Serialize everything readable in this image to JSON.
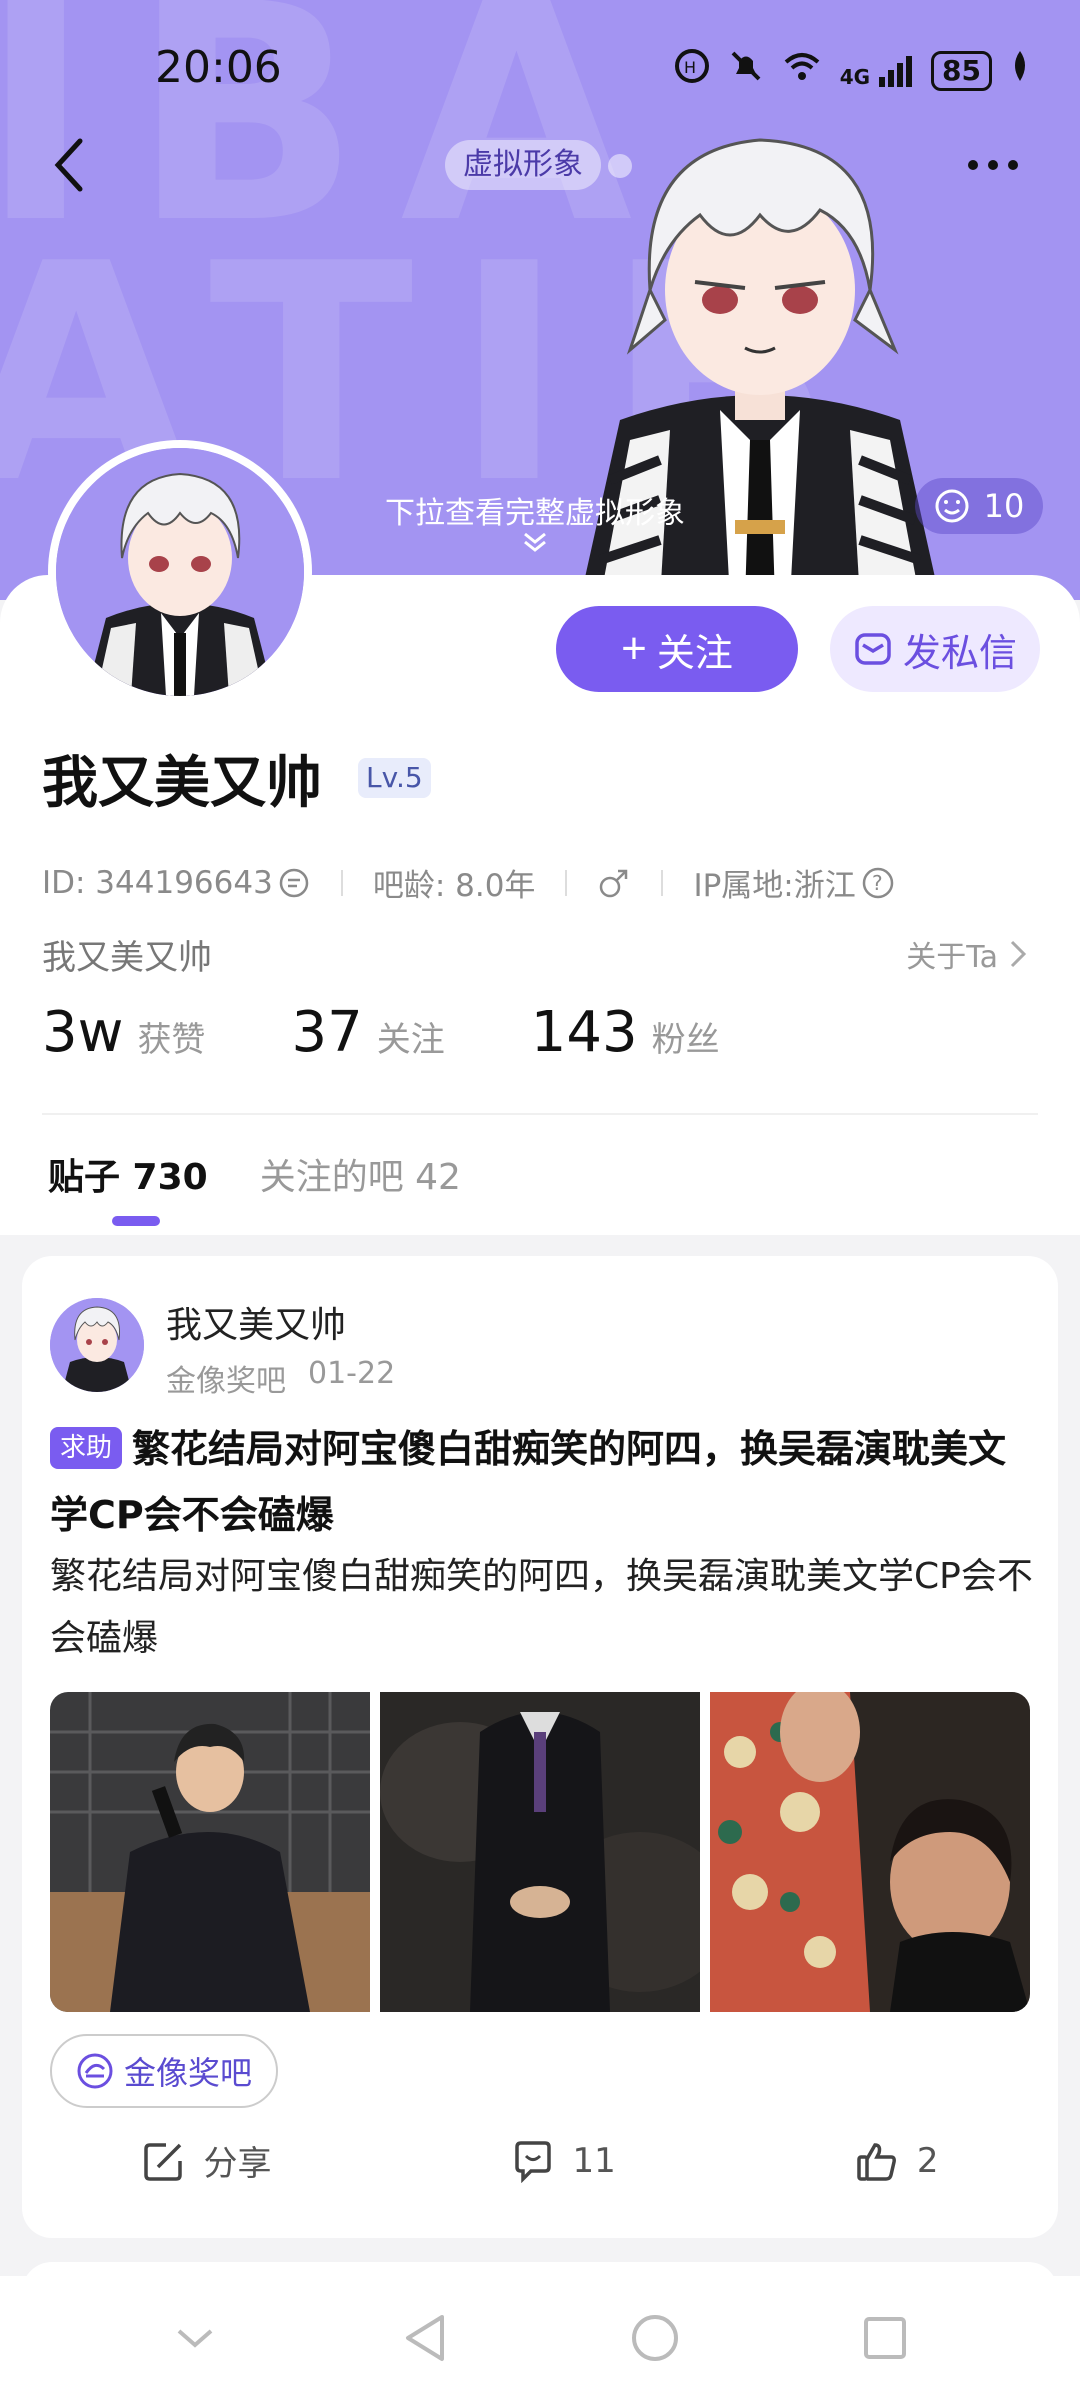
{
  "status_bar": {
    "time": "20:06",
    "network": "4G",
    "battery": "85"
  },
  "header": {
    "avatar_tag": "虚拟形象",
    "pull_hint": "下拉查看完整虚拟形象",
    "like_count": "10"
  },
  "profile": {
    "name": "我又美又帅",
    "level": "Lv.5",
    "id": "ID: 344196643",
    "bar_age": "吧龄: 8.0年",
    "gender_icon": "male-icon",
    "ip": "IP属地:浙江",
    "bio": "我又美又帅",
    "about": "关于Ta",
    "follow_button": "关注",
    "dm_button": "发私信"
  },
  "stats": [
    {
      "num": "3w",
      "label": "获赞"
    },
    {
      "num": "37",
      "label": "关注"
    },
    {
      "num": "143",
      "label": "粉丝"
    }
  ],
  "tabs": [
    {
      "label": "贴子 730",
      "active": true
    },
    {
      "label": "关注的吧 42",
      "active": false
    }
  ],
  "post": {
    "author": "我又美又帅",
    "forum": "金像奖吧",
    "date": "01-22",
    "badge": "求助",
    "title": "繁花结局对阿宝傻白甜痴笑的阿四，换吴磊演耽美文学CP会不会磕爆",
    "body": "繁花结局对阿宝傻白甜痴笑的阿四，换吴磊演耽美文学CP会不会磕爆",
    "forum_chip": "金像奖吧",
    "share_label": "分享",
    "comment_count": "11",
    "like_count": "2"
  },
  "colors": {
    "accent": "#7a5cf0",
    "hero_bg": "#a394f2"
  }
}
